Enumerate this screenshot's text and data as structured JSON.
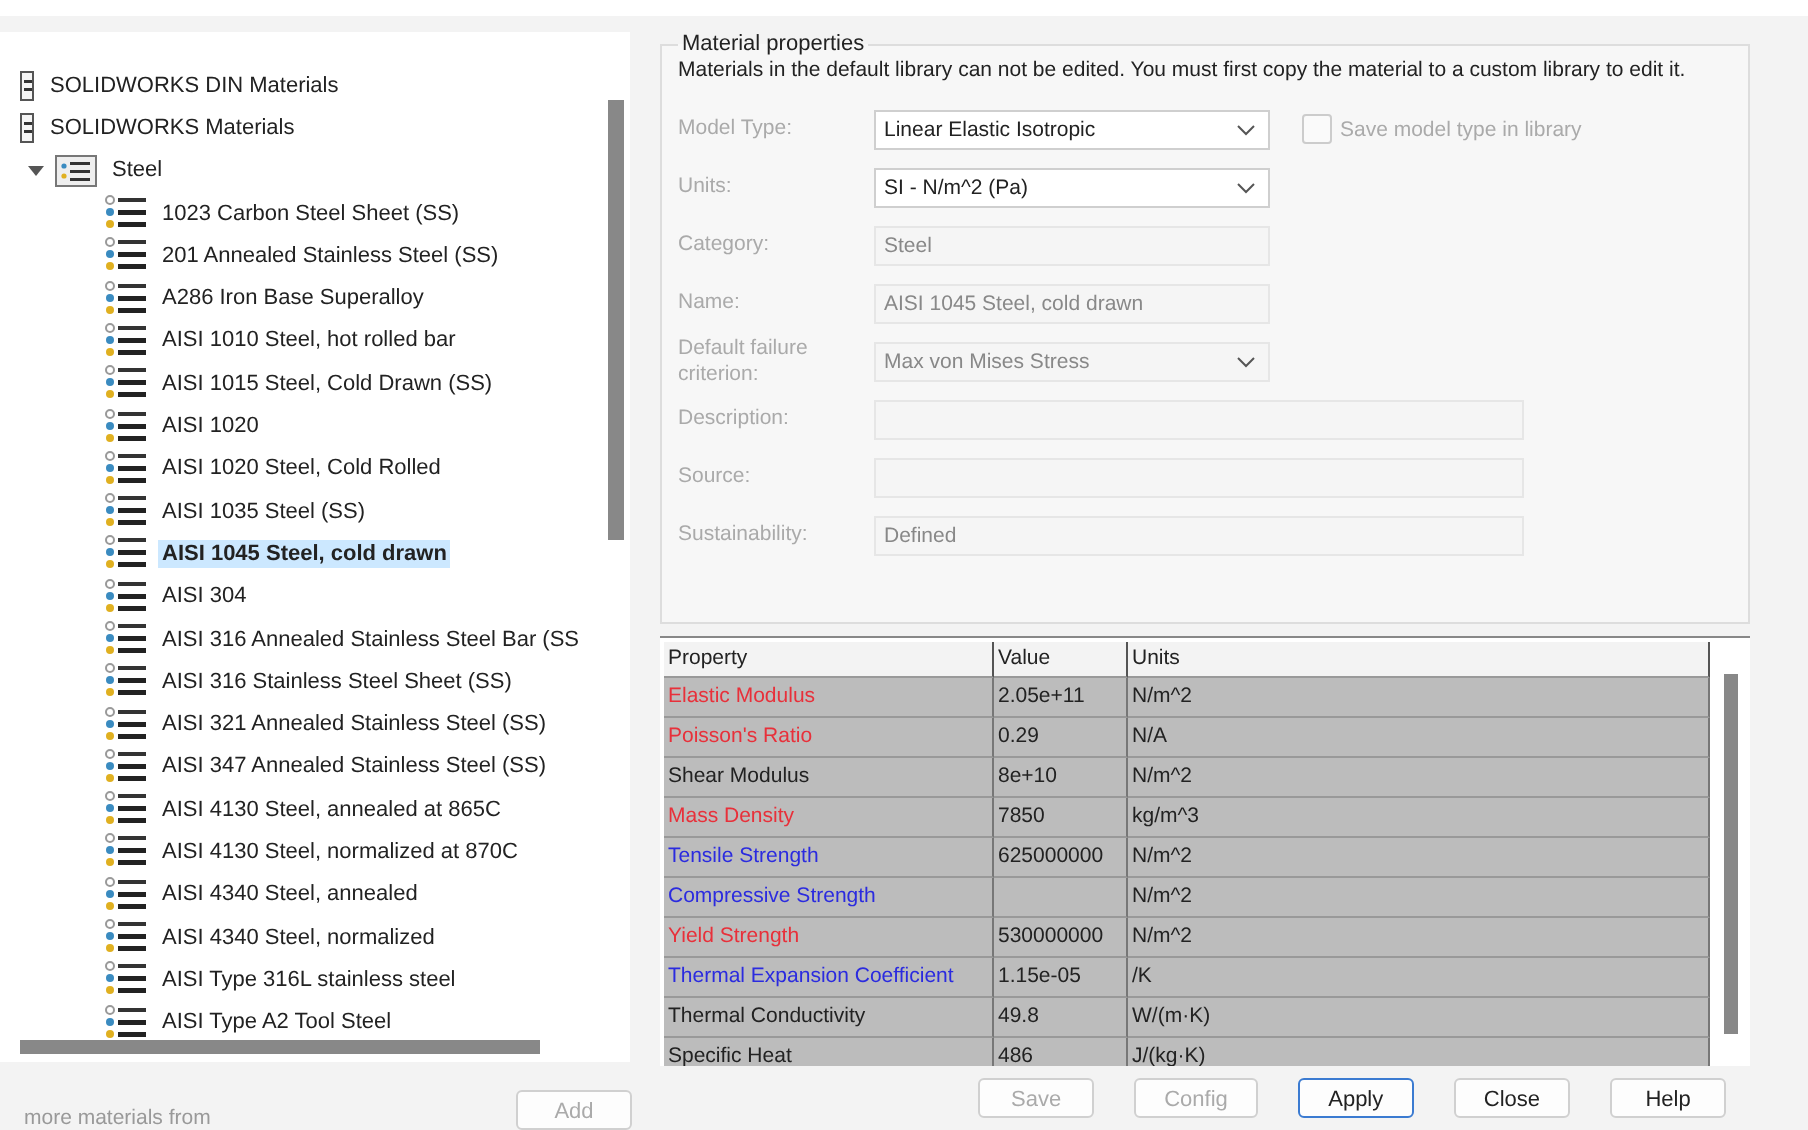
{
  "tree": {
    "libraries": [
      {
        "label": "SOLIDWORKS DIN Materials"
      },
      {
        "label": "SOLIDWORKS Materials"
      }
    ],
    "category": {
      "label": "Steel",
      "expanded": true,
      "children": [
        {
          "label": "1023 Carbon Steel Sheet (SS)",
          "selected": false
        },
        {
          "label": "201 Annealed Stainless Steel (SS)",
          "selected": false
        },
        {
          "label": "A286 Iron Base Superalloy",
          "selected": false
        },
        {
          "label": "AISI 1010 Steel, hot rolled bar",
          "selected": false
        },
        {
          "label": "AISI 1015 Steel, Cold Drawn (SS)",
          "selected": false
        },
        {
          "label": "AISI 1020",
          "selected": false
        },
        {
          "label": "AISI 1020 Steel, Cold Rolled",
          "selected": false
        },
        {
          "label": "AISI 1035 Steel (SS)",
          "selected": false
        },
        {
          "label": "AISI 1045 Steel, cold drawn",
          "selected": true
        },
        {
          "label": "AISI 304",
          "selected": false
        },
        {
          "label": "AISI 316 Annealed Stainless Steel Bar (SS",
          "selected": false
        },
        {
          "label": "AISI 316 Stainless Steel Sheet (SS)",
          "selected": false
        },
        {
          "label": "AISI 321 Annealed Stainless Steel (SS)",
          "selected": false
        },
        {
          "label": "AISI 347 Annealed Stainless Steel (SS)",
          "selected": false
        },
        {
          "label": "AISI 4130 Steel, annealed at 865C",
          "selected": false
        },
        {
          "label": "AISI 4130 Steel, normalized at 870C",
          "selected": false
        },
        {
          "label": "AISI 4340 Steel, annealed",
          "selected": false
        },
        {
          "label": "AISI 4340 Steel, normalized",
          "selected": false
        },
        {
          "label": "AISI Type 316L stainless steel",
          "selected": false
        },
        {
          "label": "AISI Type A2 Tool Steel",
          "selected": false
        }
      ]
    }
  },
  "footer_text": "more materials from",
  "add_button": {
    "label": "Add",
    "disabled": true
  },
  "properties": {
    "title": "Material properties",
    "notice": "Materials in the default library can not be edited. You must first copy the material to a custom library to edit it.",
    "fields": [
      {
        "label": "Model Type:",
        "value": "Linear Elastic Isotropic",
        "kind": "dropdown",
        "disabled": false
      },
      {
        "label": "Units:",
        "value": "SI - N/m^2 (Pa)",
        "kind": "dropdown",
        "disabled": false
      },
      {
        "label": "Category:",
        "value": "Steel",
        "kind": "text",
        "disabled": true
      },
      {
        "label": "Name:",
        "value": "AISI 1045 Steel, cold drawn",
        "kind": "text",
        "disabled": true
      },
      {
        "label": "Default failure criterion:",
        "value": "Max von Mises Stress",
        "kind": "dropdown",
        "disabled": true
      },
      {
        "label": "Description:",
        "kind": "wide",
        "disabled": true
      },
      {
        "label": "Source:",
        "kind": "wide",
        "disabled": true
      },
      {
        "label": "Sustainability:",
        "value": "Defined",
        "kind": "wide",
        "disabled": true
      }
    ],
    "save_model_type": {
      "label": "Save model type in library",
      "checked": false
    }
  },
  "table": {
    "columns": [
      "Property",
      "Value",
      "Units"
    ],
    "rows": [
      {
        "property": "Elastic Modulus",
        "value": "2.05e+11",
        "units": "N/m^2",
        "color": "#e8303a"
      },
      {
        "property": "Poisson's Ratio",
        "value": "0.29",
        "units": "N/A",
        "color": "#e8303a"
      },
      {
        "property": "Shear Modulus",
        "value": "8e+10",
        "units": "N/m^2",
        "color": "#222222"
      },
      {
        "property": "Mass Density",
        "value": "7850",
        "units": "kg/m^3",
        "color": "#e8303a"
      },
      {
        "property": "Tensile Strength",
        "value": "625000000",
        "units": "N/m^2",
        "color": "#2b2bdf"
      },
      {
        "property": "Compressive Strength",
        "units": "N/m^2",
        "color": "#2b2bdf"
      },
      {
        "property": "Yield Strength",
        "value": "530000000",
        "units": "N/m^2",
        "color": "#e8303a"
      },
      {
        "property": "Thermal Expansion Coefficient",
        "value": "1.15e-05",
        "units": "/K",
        "color": "#2b2bdf"
      },
      {
        "property": "Thermal Conductivity",
        "value": "49.8",
        "units": "W/(m·K)",
        "color": "#222222"
      },
      {
        "property": "Specific Heat",
        "value": "486",
        "units": "J/(kg·K)",
        "color": "#222222"
      }
    ]
  },
  "buttons": [
    {
      "label": "Save",
      "disabled": true,
      "default": false
    },
    {
      "label": "Config",
      "disabled": true,
      "default": false
    },
    {
      "label": "Apply",
      "disabled": false,
      "default": true
    },
    {
      "label": "Close",
      "disabled": false,
      "default": false
    },
    {
      "label": "Help",
      "disabled": false,
      "default": false
    }
  ]
}
